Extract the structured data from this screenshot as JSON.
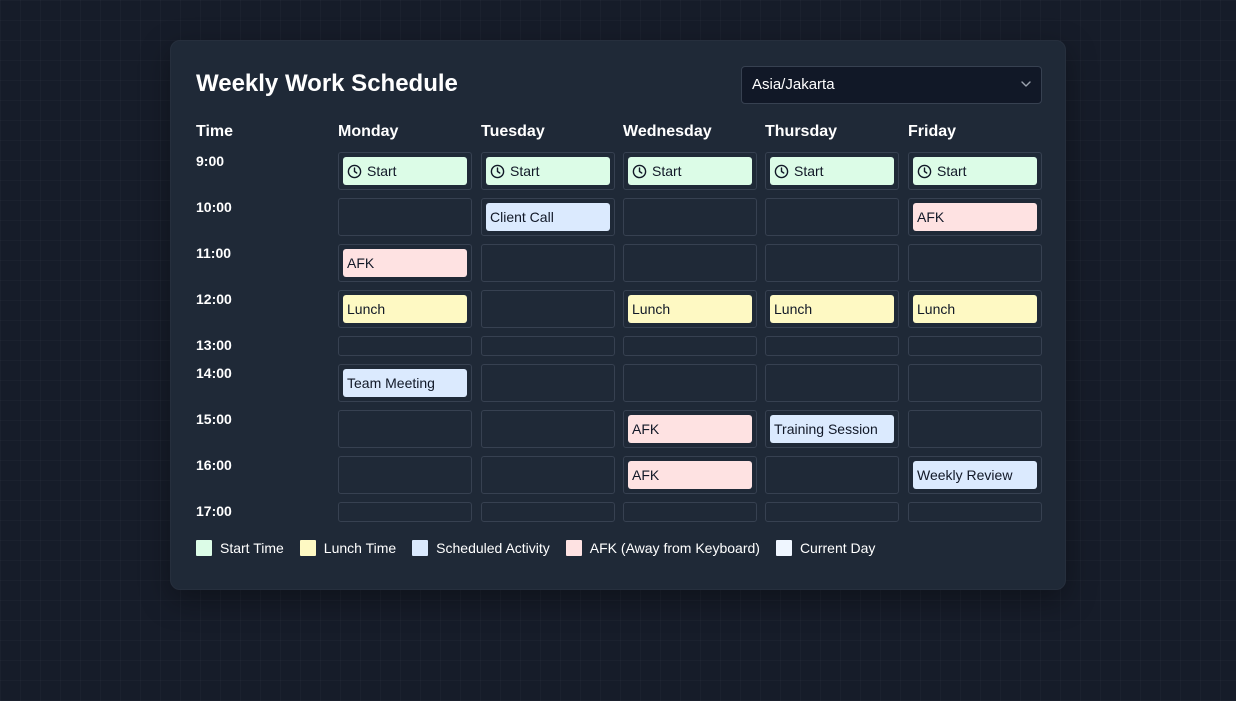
{
  "title": "Weekly Work Schedule",
  "timezone": {
    "selected": "Asia/Jakarta"
  },
  "grid": {
    "time_header": "Time",
    "days": [
      "Monday",
      "Tuesday",
      "Wednesday",
      "Thursday",
      "Friday"
    ],
    "rows": [
      {
        "time": "9:00",
        "cells": [
          {
            "label": "Start",
            "type": "start"
          },
          {
            "label": "Start",
            "type": "start"
          },
          {
            "label": "Start",
            "type": "start"
          },
          {
            "label": "Start",
            "type": "start"
          },
          {
            "label": "Start",
            "type": "start"
          }
        ]
      },
      {
        "time": "10:00",
        "cells": [
          null,
          {
            "label": "Client Call",
            "type": "scheduled"
          },
          null,
          null,
          {
            "label": "AFK",
            "type": "afk"
          }
        ]
      },
      {
        "time": "11:00",
        "cells": [
          {
            "label": "AFK",
            "type": "afk"
          },
          null,
          null,
          null,
          null
        ]
      },
      {
        "time": "12:00",
        "cells": [
          {
            "label": "Lunch",
            "type": "lunch"
          },
          null,
          {
            "label": "Lunch",
            "type": "lunch"
          },
          {
            "label": "Lunch",
            "type": "lunch"
          },
          {
            "label": "Lunch",
            "type": "lunch"
          }
        ]
      },
      {
        "time": "13:00",
        "cells": [
          null,
          null,
          null,
          null,
          null
        ]
      },
      {
        "time": "14:00",
        "cells": [
          {
            "label": "Team Meeting",
            "type": "scheduled"
          },
          null,
          null,
          null,
          null
        ]
      },
      {
        "time": "15:00",
        "cells": [
          null,
          null,
          {
            "label": "AFK",
            "type": "afk"
          },
          {
            "label": "Training Session",
            "type": "scheduled"
          },
          null
        ]
      },
      {
        "time": "16:00",
        "cells": [
          null,
          null,
          {
            "label": "AFK",
            "type": "afk"
          },
          null,
          {
            "label": "Weekly Review",
            "type": "scheduled"
          }
        ]
      },
      {
        "time": "17:00",
        "cells": [
          null,
          null,
          null,
          null,
          null
        ]
      }
    ]
  },
  "legend": [
    {
      "label": "Start Time",
      "color": "#dcfce7"
    },
    {
      "label": "Lunch Time",
      "color": "#fef9c3"
    },
    {
      "label": "Scheduled Activity",
      "color": "#dbeafe"
    },
    {
      "label": "AFK (Away from Keyboard)",
      "color": "#fee2e2"
    },
    {
      "label": "Current Day",
      "color": "#eff6ff"
    }
  ],
  "colors": {
    "background": "#161c29",
    "card": "#1f2937",
    "cell_border": "#374151",
    "start": "#dcfce7",
    "lunch": "#fef9c3",
    "scheduled": "#dbeafe",
    "afk": "#fee2e2"
  },
  "icons": {
    "start_event": "clock-icon",
    "dropdown": "chevron-down-icon"
  }
}
